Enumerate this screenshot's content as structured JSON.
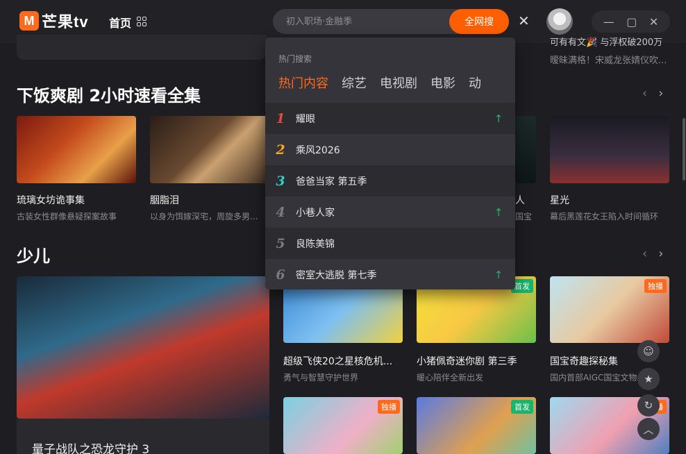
{
  "header": {
    "logo_mark": "M",
    "logo_text": "芒果tv",
    "nav_home": "首页",
    "search_placeholder": "初入职场·金融季",
    "search_button": "全网搜",
    "close_glyph": "✕",
    "window_controls": [
      "—",
      "▢",
      "✕"
    ]
  },
  "top_strip": {
    "right_title": "可有有文🎉 与浮权破200万",
    "right_sub": "暧昧满格！宋威龙张婧仪吹..."
  },
  "section1": {
    "title": "下饭爽剧 2小时速看全集",
    "arrows": [
      "‹",
      "›"
    ],
    "cards": [
      {
        "title": "琉璃女坊诡事集",
        "sub": "古装女性群像悬疑探案故事"
      },
      {
        "title": "胭脂泪",
        "sub": "以身为饵嫁深宅，周旋多男..."
      },
      {
        "title": "人",
        "sub": "国宝"
      },
      {
        "title": "星光",
        "sub": "幕后黑莲花女王陷入时间循环"
      }
    ]
  },
  "section2": {
    "title": "少儿",
    "arrows": [
      "‹",
      "›"
    ],
    "feature_title": "量子战队之恐龙守护 3",
    "cards": [
      {
        "title": "超级飞侠20之星核危机...",
        "sub": "勇气与智慧守护世界",
        "badge": ""
      },
      {
        "title": "小猪佩奇迷你剧 第三季",
        "sub": "暖心陪伴全新出发",
        "badge": "首发"
      },
      {
        "title": "国宝奇趣探秘集",
        "sub": "国内首部AIGC国宝文物...",
        "badge": "独播"
      }
    ],
    "row2_badges": [
      "独播",
      "首发",
      "独播"
    ]
  },
  "dropdown": {
    "heading": "热门搜索",
    "tabs": [
      "热门内容",
      "综艺",
      "电视剧",
      "电影",
      "动"
    ],
    "items": [
      {
        "rank": "1",
        "title": "耀眼",
        "trend": "↑",
        "rank_color": "#e8473b"
      },
      {
        "rank": "2",
        "title": "乘风2026",
        "trend": "",
        "rank_color": "#f5a623"
      },
      {
        "rank": "3",
        "title": "爸爸当家 第五季",
        "trend": "",
        "rank_color": "#2fd1c0"
      },
      {
        "rank": "4",
        "title": "小巷人家",
        "trend": "↑",
        "rank_color": "#7a7a80"
      },
      {
        "rank": "5",
        "title": "良陈美锦",
        "trend": "",
        "rank_color": "#7a7a80"
      },
      {
        "rank": "6",
        "title": "密室大逃脱 第七季",
        "trend": "↑",
        "rank_color": "#7a7a80"
      }
    ]
  },
  "fabs": [
    "robot-icon",
    "star-icon",
    "refresh-icon",
    "up-icon"
  ],
  "colors": {
    "accent": "#ff5f00",
    "bg": "#1e1e22",
    "up_green": "#27b36b"
  }
}
